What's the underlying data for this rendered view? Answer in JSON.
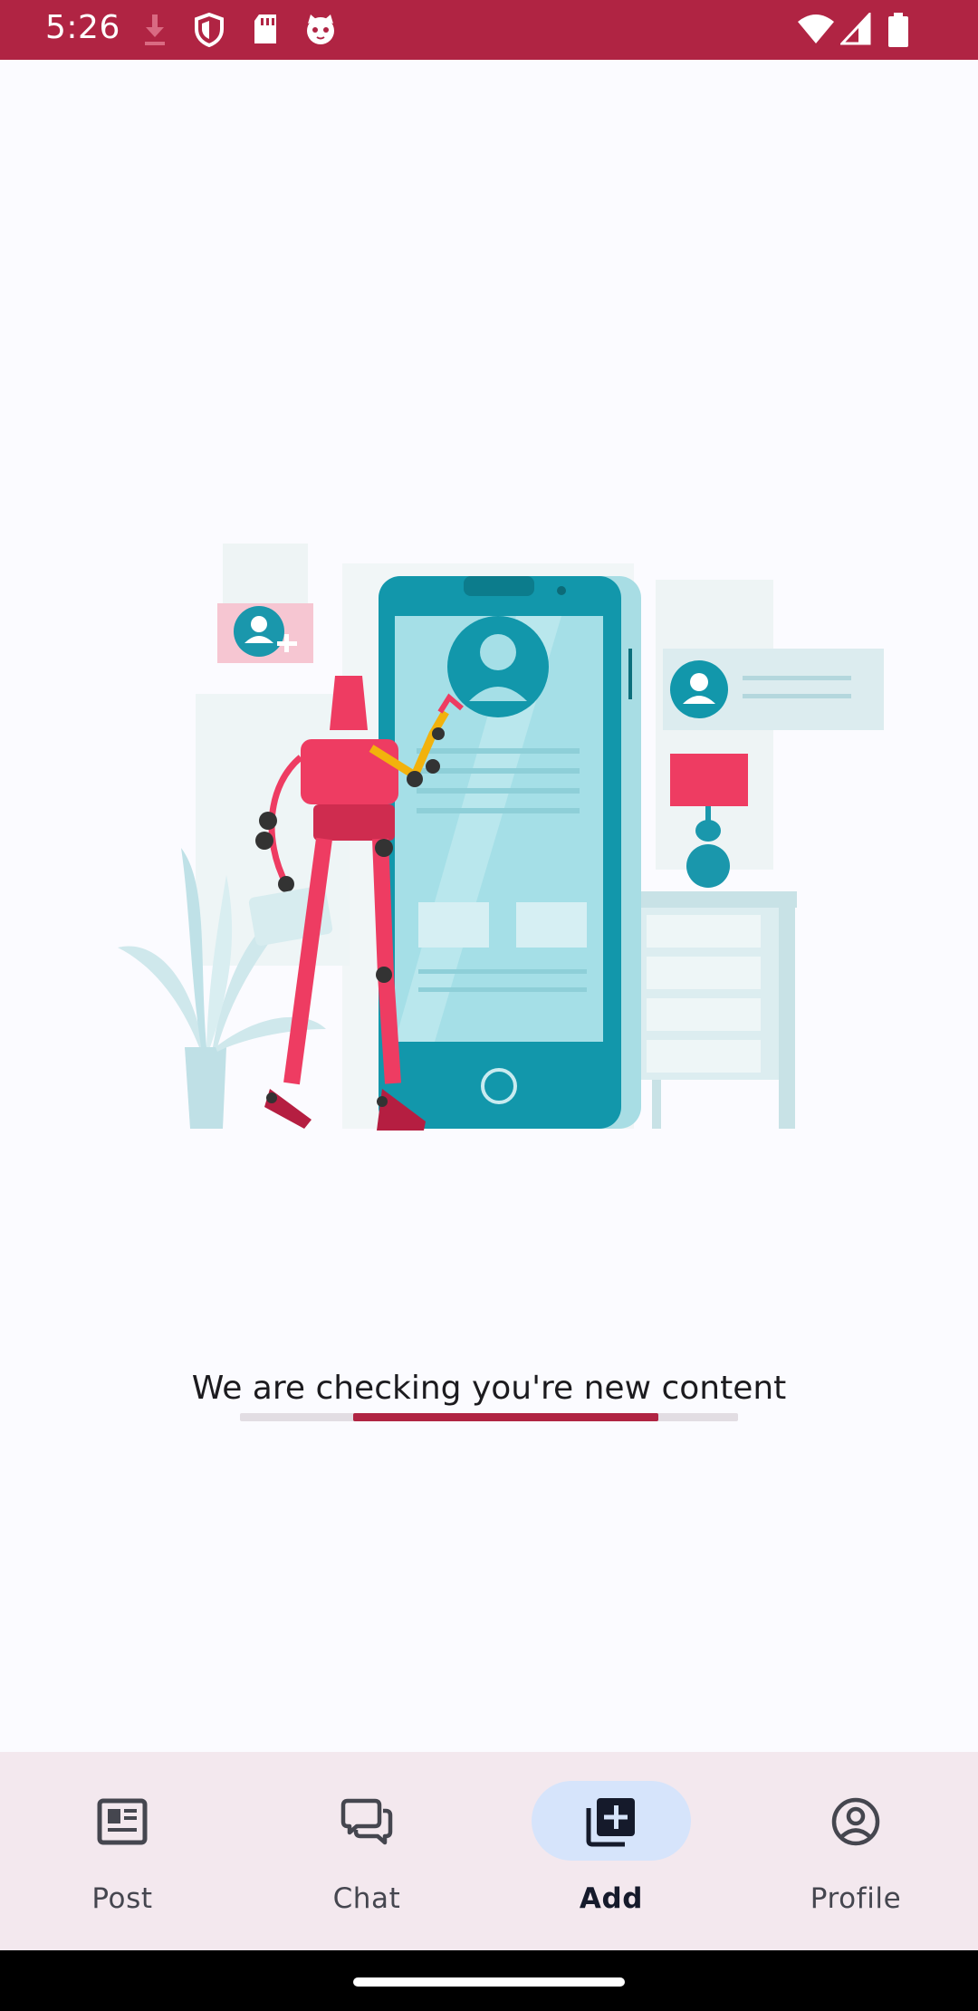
{
  "status_bar": {
    "time": "5:26",
    "icons_left": [
      "download-icon",
      "shield-icon",
      "sd-card-icon",
      "cat-face-icon"
    ],
    "icons_right": [
      "wifi-icon",
      "cellular-signal-icon",
      "battery-icon"
    ],
    "background": "#b02443"
  },
  "main": {
    "illustration": "robot-with-phone-profile-illustration",
    "loading_text": "We are checking you're new content",
    "progress": {
      "track_color": "#e2dde3",
      "fill_color": "#b02443",
      "start_fraction": 0.227,
      "end_fraction": 0.84
    }
  },
  "bottom_nav": {
    "items": [
      {
        "label": "Post",
        "icon": "article-icon",
        "active": false
      },
      {
        "label": "Chat",
        "icon": "chat-bubbles-icon",
        "active": false
      },
      {
        "label": "Add",
        "icon": "add-library-icon",
        "active": true
      },
      {
        "label": "Profile",
        "icon": "account-circle-icon",
        "active": false
      }
    ],
    "background": "#f3e8ee",
    "active_indicator_color": "#d6e4fb"
  }
}
